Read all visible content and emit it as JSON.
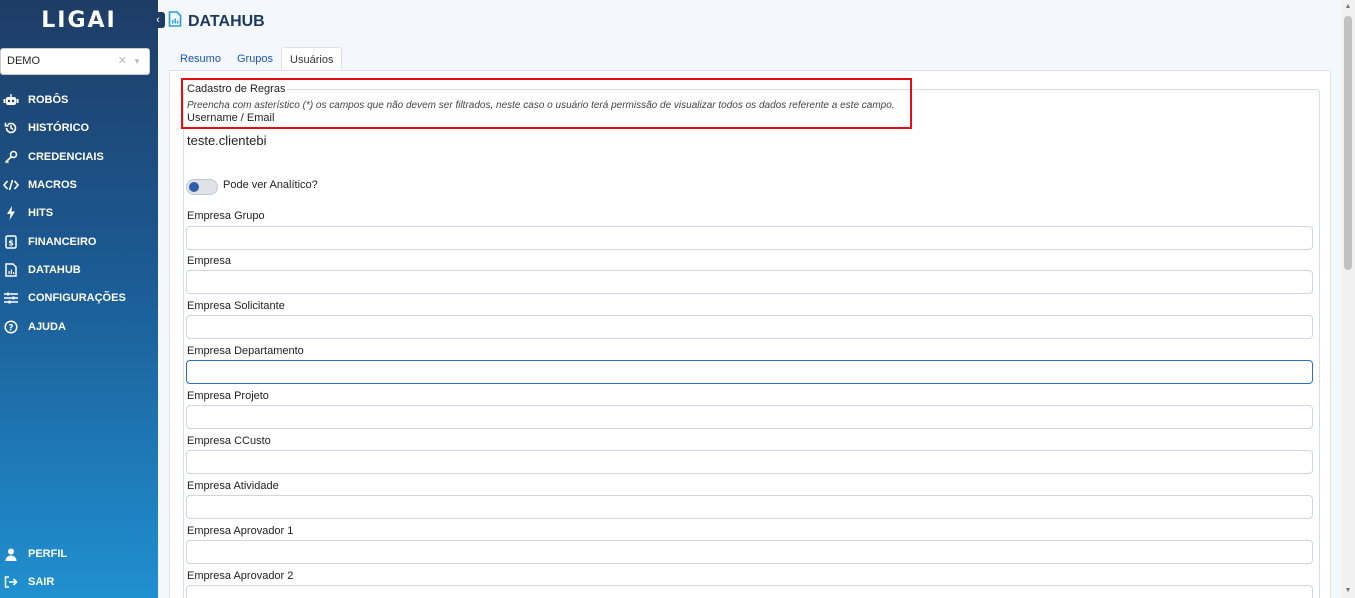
{
  "app": {
    "logo_text": "LIGAI"
  },
  "org_select": {
    "value": "DEMO"
  },
  "sidebar": {
    "items": [
      {
        "label": "ROBÔS",
        "icon": "robot-icon"
      },
      {
        "label": "HISTÓRICO",
        "icon": "history-icon"
      },
      {
        "label": "CREDENCIAIS",
        "icon": "key-icon"
      },
      {
        "label": "MACROS",
        "icon": "code-icon"
      },
      {
        "label": "HITS",
        "icon": "bolt-icon"
      },
      {
        "label": "FINANCEIRO",
        "icon": "invoice-icon"
      },
      {
        "label": "DATAHUB",
        "icon": "file-chart-icon"
      },
      {
        "label": "CONFIGURAÇÕES",
        "icon": "sliders-icon"
      },
      {
        "label": "AJUDA",
        "icon": "help-circle-icon"
      }
    ],
    "bottom_items": [
      {
        "label": "PERFIL",
        "icon": "user-icon"
      },
      {
        "label": "SAIR",
        "icon": "logout-icon"
      }
    ]
  },
  "header": {
    "title": "DATAHUB"
  },
  "tabs": [
    "Resumo",
    "Grupos",
    "Usuários"
  ],
  "active_tab": "Usuários",
  "form": {
    "legend": "Cadastro de Regras",
    "hint": "Preencha com asterístico (*) os campos que não devem ser filtrados, neste caso o usuário terá permissão de visualizar todos os dados referente a este campo.",
    "username_label": "Username / Email",
    "username_value": "teste.clientebi",
    "toggle_label": "Pode ver Analítico?",
    "fields": [
      {
        "label": "Empresa Grupo",
        "value": ""
      },
      {
        "label": "Empresa",
        "value": ""
      },
      {
        "label": "Empresa Solicitante",
        "value": ""
      },
      {
        "label": "Empresa Departamento",
        "value": ""
      },
      {
        "label": "Empresa Projeto",
        "value": ""
      },
      {
        "label": "Empresa CCusto",
        "value": ""
      },
      {
        "label": "Empresa Atividade",
        "value": ""
      },
      {
        "label": "Empresa Aprovador 1",
        "value": ""
      },
      {
        "label": "Empresa Aprovador 2",
        "value": ""
      }
    ]
  },
  "colors": {
    "highlight": "#e01010",
    "accent": "#1a56b8",
    "sidebar_top": "#1e3d66",
    "sidebar_bottom": "#2090d0"
  }
}
